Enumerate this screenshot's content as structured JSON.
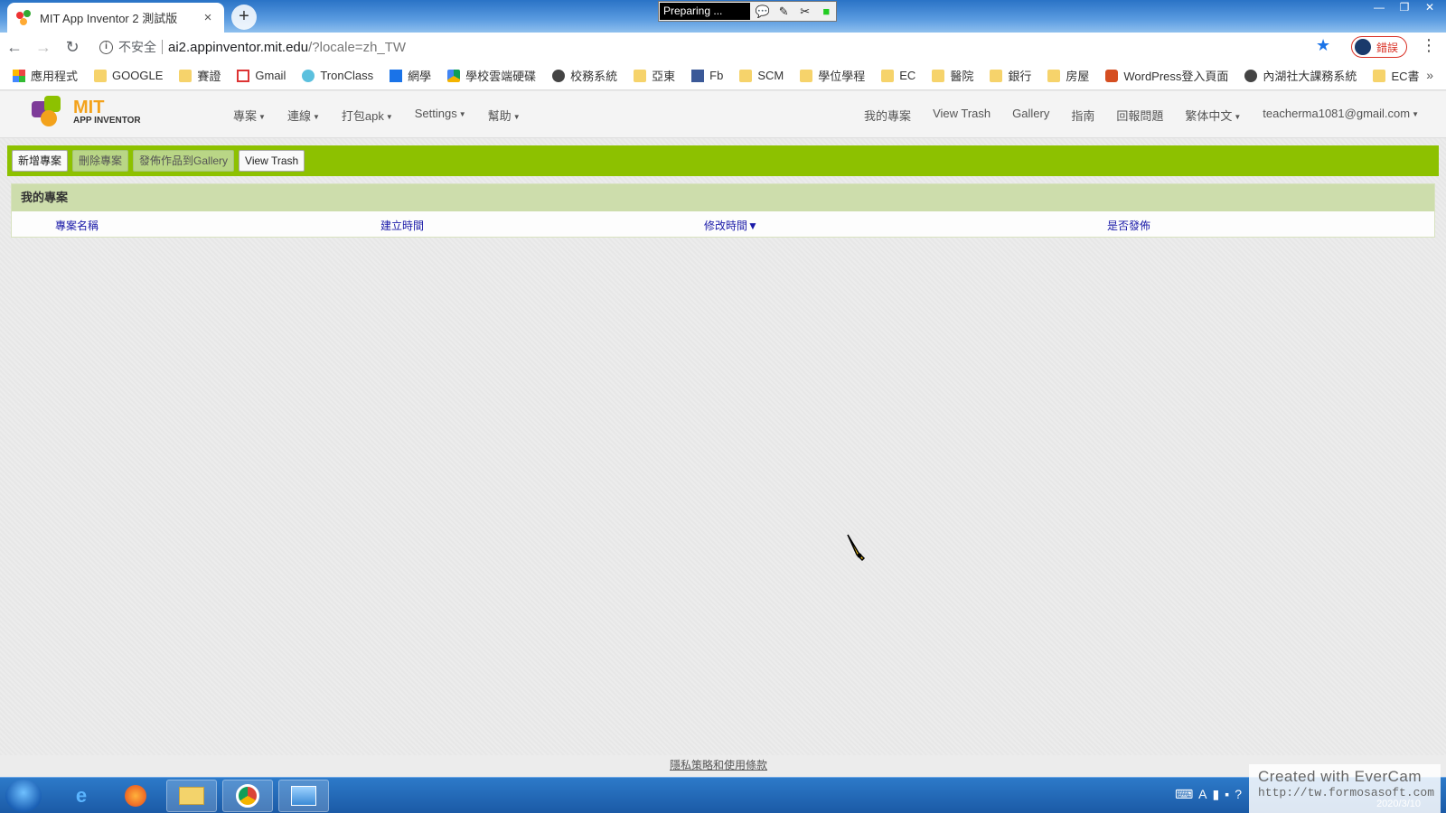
{
  "browser": {
    "tab_title": "MIT App Inventor 2 測試版",
    "tab_close": "×",
    "new_tab": "+",
    "evercam_status": "Preparing ...",
    "window_controls": [
      "—",
      "❐",
      "✕"
    ],
    "nav": {
      "back": "←",
      "forward": "→",
      "reload": "↻"
    },
    "security_label": "不安全",
    "url_host": "ai2.appinventor.mit.edu",
    "url_path": "/?locale=zh_TW",
    "profile_label": "錯誤",
    "menu": "⋮"
  },
  "bookmarks": [
    {
      "label": "應用程式",
      "icon": "apps-grid-icon"
    },
    {
      "label": "GOOGLE",
      "icon": "folder-icon"
    },
    {
      "label": "賽證",
      "icon": "folder-icon"
    },
    {
      "label": "Gmail",
      "icon": "gmail-icon"
    },
    {
      "label": "TronClass",
      "icon": "tronclass-icon"
    },
    {
      "label": "網學",
      "icon": "m-icon"
    },
    {
      "label": "學校雲端硬碟",
      "icon": "drive-icon"
    },
    {
      "label": "校務系統",
      "icon": "globe-icon"
    },
    {
      "label": "亞東",
      "icon": "folder-icon"
    },
    {
      "label": "Fb",
      "icon": "facebook-icon"
    },
    {
      "label": "SCM",
      "icon": "folder-icon"
    },
    {
      "label": "學位學程",
      "icon": "folder-icon"
    },
    {
      "label": "EC",
      "icon": "folder-icon"
    },
    {
      "label": "醫院",
      "icon": "folder-icon"
    },
    {
      "label": "銀行",
      "icon": "folder-icon"
    },
    {
      "label": "房屋",
      "icon": "folder-icon"
    },
    {
      "label": "WordPress登入頁面",
      "icon": "wordpress-icon"
    },
    {
      "label": "內湖社大課務系統",
      "icon": "globe-icon"
    },
    {
      "label": "EC書",
      "icon": "folder-icon"
    }
  ],
  "bookmarks_more": "»",
  "app": {
    "logo_mit": "MIT",
    "logo_sub": "APP INVENTOR",
    "menu_left": [
      "專案",
      "連線",
      "打包apk",
      "Settings",
      "幫助"
    ],
    "menu_right": [
      {
        "label": "我的專案",
        "dropdown": false
      },
      {
        "label": "View Trash",
        "dropdown": false
      },
      {
        "label": "Gallery",
        "dropdown": false
      },
      {
        "label": "指南",
        "dropdown": false
      },
      {
        "label": "回報問題",
        "dropdown": false
      },
      {
        "label": "繁体中文",
        "dropdown": true
      },
      {
        "label": "teacherma1081@gmail.com",
        "dropdown": true
      }
    ],
    "toolbar": {
      "new_project": "新增專案",
      "delete_project": "刪除專案",
      "publish_gallery": "發佈作品到Gallery",
      "view_trash": "View Trash"
    },
    "project_list": {
      "title": "我的專案",
      "columns": [
        "專案名稱",
        "建立時間",
        "修改時間▼",
        "是否發佈"
      ]
    },
    "footer_link": "隱私策略和使用條款"
  },
  "watermark": {
    "line1": "Created  with  EverCam",
    "line2": "http://tw.formosasoft.com"
  },
  "clock": "2020/3/10",
  "colors": {
    "toolbar_green": "#8dc100",
    "list_header": "#cdddac",
    "logo_orange": "#f3a21b",
    "column_link": "#1a1aa8"
  }
}
